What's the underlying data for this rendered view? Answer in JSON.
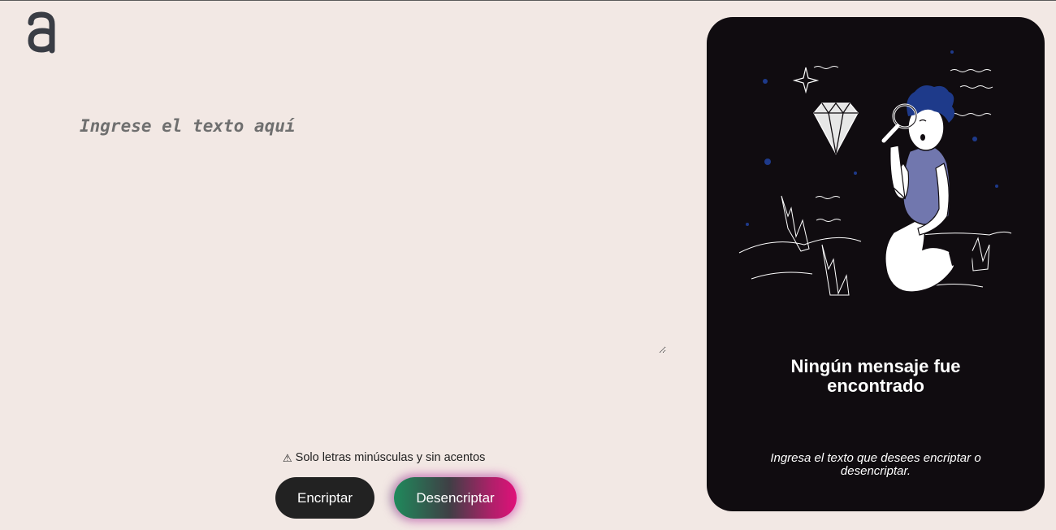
{
  "logo": {
    "icon": "alura-logo-icon"
  },
  "input": {
    "placeholder": "Ingrese el texto aquí",
    "value": ""
  },
  "warning": {
    "icon": "warning-icon",
    "text": "Solo letras minúsculas y sin acentos"
  },
  "buttons": {
    "encrypt_label": "Encriptar",
    "decrypt_label": "Desencriptar"
  },
  "output_panel": {
    "illustration": "person-with-magnifying-glass-illustration",
    "title": "Ningún mensaje fue encontrado",
    "subtitle": "Ingresa el texto que desees encriptar o desencriptar."
  },
  "colors": {
    "background": "#f2e8e4",
    "panel": "#100c10",
    "encrypt_button": "#222222",
    "decrypt_gradient_start": "#1f8a5c",
    "decrypt_gradient_end": "#e0107a"
  }
}
